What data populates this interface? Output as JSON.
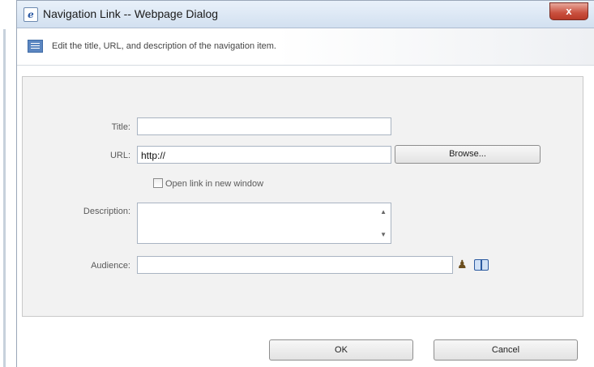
{
  "window": {
    "title": "Navigation Link -- Webpage Dialog",
    "close_label": "x"
  },
  "header": {
    "description": "Edit the title, URL, and description of the navigation item."
  },
  "form": {
    "title_label": "Title:",
    "title_value": "",
    "url_label": "URL:",
    "url_value": "http://",
    "browse_label": "Browse...",
    "open_new_window_label": "Open link in new window",
    "open_new_window_checked": false,
    "description_label": "Description:",
    "description_value": "",
    "audience_label": "Audience:",
    "audience_value": ""
  },
  "footer": {
    "ok_label": "OK",
    "cancel_label": "Cancel"
  },
  "icons": {
    "app": "ie-icon",
    "header": "list-icon",
    "people_picker": "people-picker-icon",
    "address_book": "address-book-icon"
  }
}
